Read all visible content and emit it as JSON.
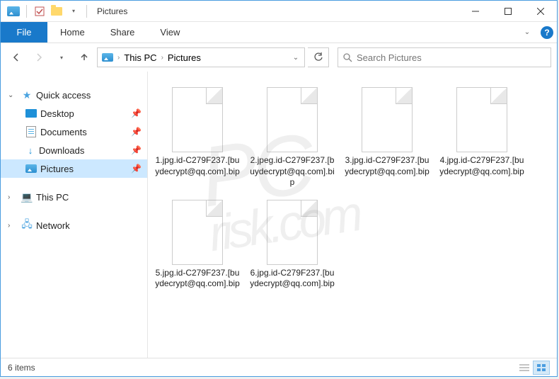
{
  "titlebar": {
    "title": "Pictures"
  },
  "ribbon": {
    "file": "File",
    "tabs": [
      "Home",
      "Share",
      "View"
    ]
  },
  "address": {
    "crumbs": [
      "This PC",
      "Pictures"
    ]
  },
  "search": {
    "placeholder": "Search Pictures"
  },
  "sidebar": {
    "quick_access": "Quick access",
    "items": [
      {
        "label": "Desktop"
      },
      {
        "label": "Documents"
      },
      {
        "label": "Downloads"
      },
      {
        "label": "Pictures"
      }
    ],
    "this_pc": "This PC",
    "network": "Network"
  },
  "files": [
    {
      "name": "1.jpg.id-C279F237.[buydecrypt@qq.com].bip"
    },
    {
      "name": "2.jpeg.id-C279F237.[buydecrypt@qq.com].bip"
    },
    {
      "name": "3.jpg.id-C279F237.[buydecrypt@qq.com].bip"
    },
    {
      "name": "4.jpg.id-C279F237.[buydecrypt@qq.com].bip"
    },
    {
      "name": "5.jpg.id-C279F237.[buydecrypt@qq.com].bip"
    },
    {
      "name": "6.jpg.id-C279F237.[buydecrypt@qq.com].bip"
    }
  ],
  "statusbar": {
    "count": "6 items"
  },
  "watermark": {
    "line1": "PC",
    "line2": "risk.com"
  }
}
